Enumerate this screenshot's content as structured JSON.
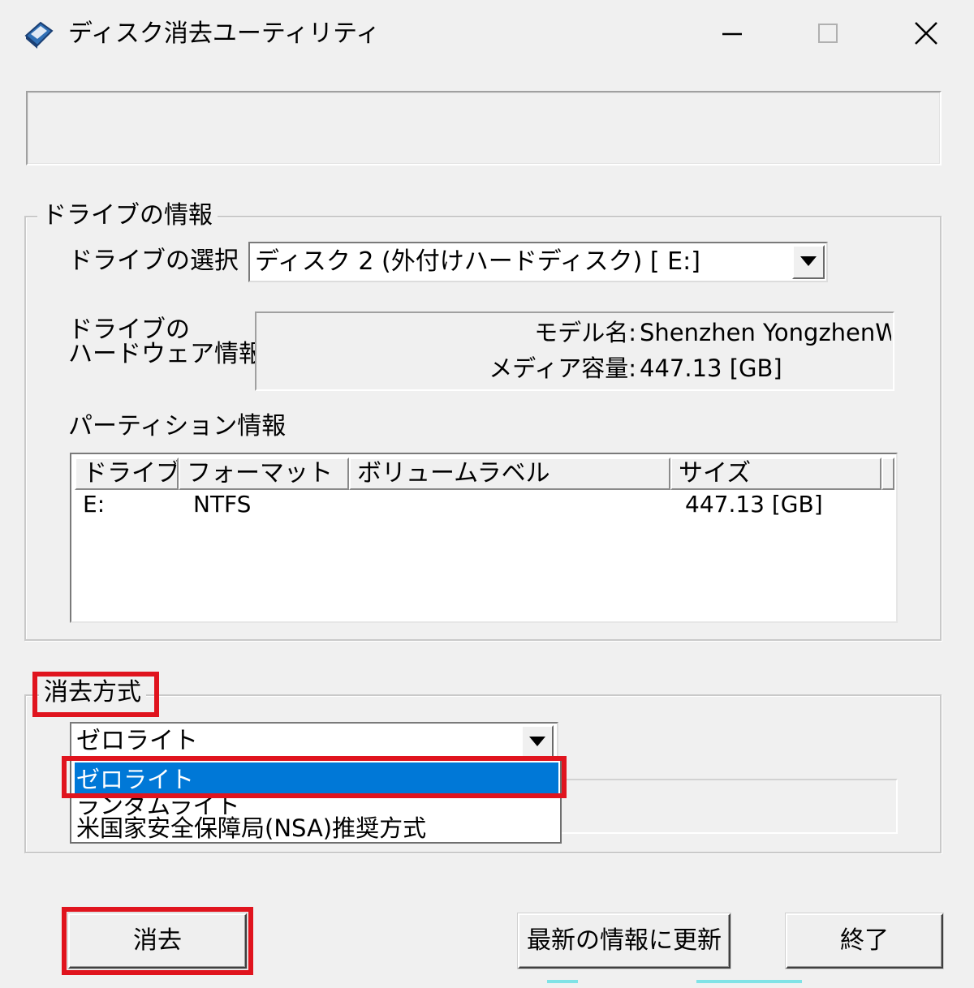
{
  "window": {
    "title": "ディスク消去ユーティリティ",
    "minimize_glyph": "—",
    "maximize_glyph": "☐",
    "close_glyph": "✕"
  },
  "drive_info": {
    "group_title": "ドライブの情報",
    "select_label": "ドライブの選択",
    "selected_drive": "ディスク 2 (外付けハードディスク) [ E:]",
    "hardware_label_line1": "ドライブの",
    "hardware_label_line2": "ハードウェア情報",
    "model_label": "モデル名:",
    "model_value": "Shenzhen YongzhenWeiye SCSI Disk De...",
    "capacity_label": "メディア容量:",
    "capacity_value": "447.13 [GB]",
    "partition_label": "パーティション情報",
    "partition_columns": [
      "ドライブ",
      "フォーマット",
      "ボリュームラベル",
      "サイズ"
    ],
    "partitions": [
      {
        "drive": "E:",
        "format": "NTFS",
        "label": "",
        "size": "447.13 [GB]"
      }
    ]
  },
  "erase_method": {
    "group_title": "消去方式",
    "selected": "ゼロライト",
    "options": [
      "ゼロライト",
      "ランダムライト",
      "米国家安全保障局(NSA)推奨方式"
    ]
  },
  "buttons": {
    "erase": "消去",
    "refresh": "最新の情報に更新",
    "exit": "終了"
  },
  "colors": {
    "highlight": "#e0141e",
    "selection": "#0078d7",
    "background": "#f0f0f0"
  }
}
